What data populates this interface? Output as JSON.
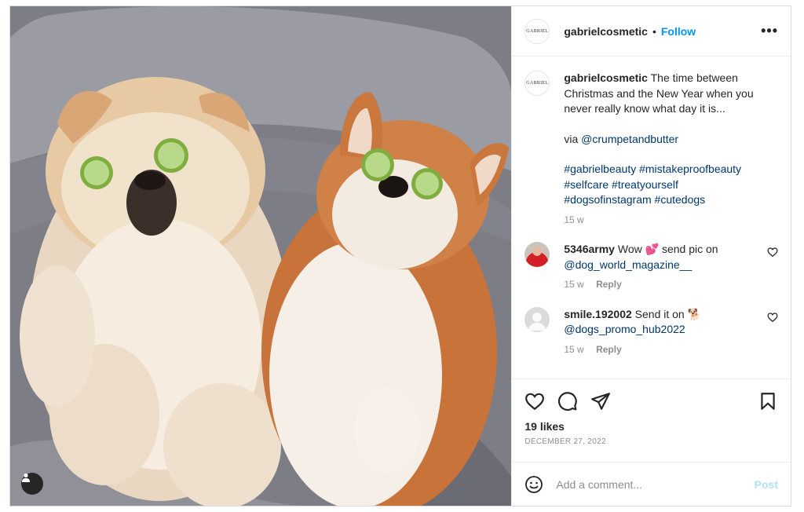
{
  "post": {
    "author": "gabrielcosmetic",
    "logo_text": "GABRIEL",
    "dot": "•",
    "follow_label": "Follow",
    "more_label": "•••",
    "caption": {
      "text": "The time between Christmas and the New Year when you never really know what day it is...",
      "via_prefix": "via ",
      "via_mention": "@crumpetandbutter",
      "hashtags_line1": "#gabrielbeauty #mistakeproofbeauty",
      "hashtags_line2": "#selfcare #treatyourself",
      "hashtags_line3": "#dogsofinstagram #cutedogs",
      "time": "15 w"
    },
    "comments": [
      {
        "username": "5346army",
        "text": "Wow 💕 send pic on",
        "mention": "@dog_world_magazine__",
        "time": "15 w",
        "reply_label": "Reply"
      },
      {
        "username": "smile.192002",
        "text": "Send it on 🐕",
        "mention": "@dogs_promo_hub2022",
        "time": "15 w",
        "reply_label": "Reply"
      }
    ],
    "likes": "19 likes",
    "date": "DECEMBER 27, 2022",
    "add_comment_placeholder": "Add a comment...",
    "post_label": "Post"
  },
  "icons": {
    "user_tag": "person-icon",
    "like": "heart-icon",
    "comment": "comment-icon",
    "share": "paper-plane-icon",
    "save": "bookmark-icon",
    "emoji": "smiley-icon"
  },
  "colors": {
    "accent": "#0095f6",
    "link": "#00376b",
    "muted": "#8e8e8e",
    "post_disabled": "#b2dffc"
  }
}
